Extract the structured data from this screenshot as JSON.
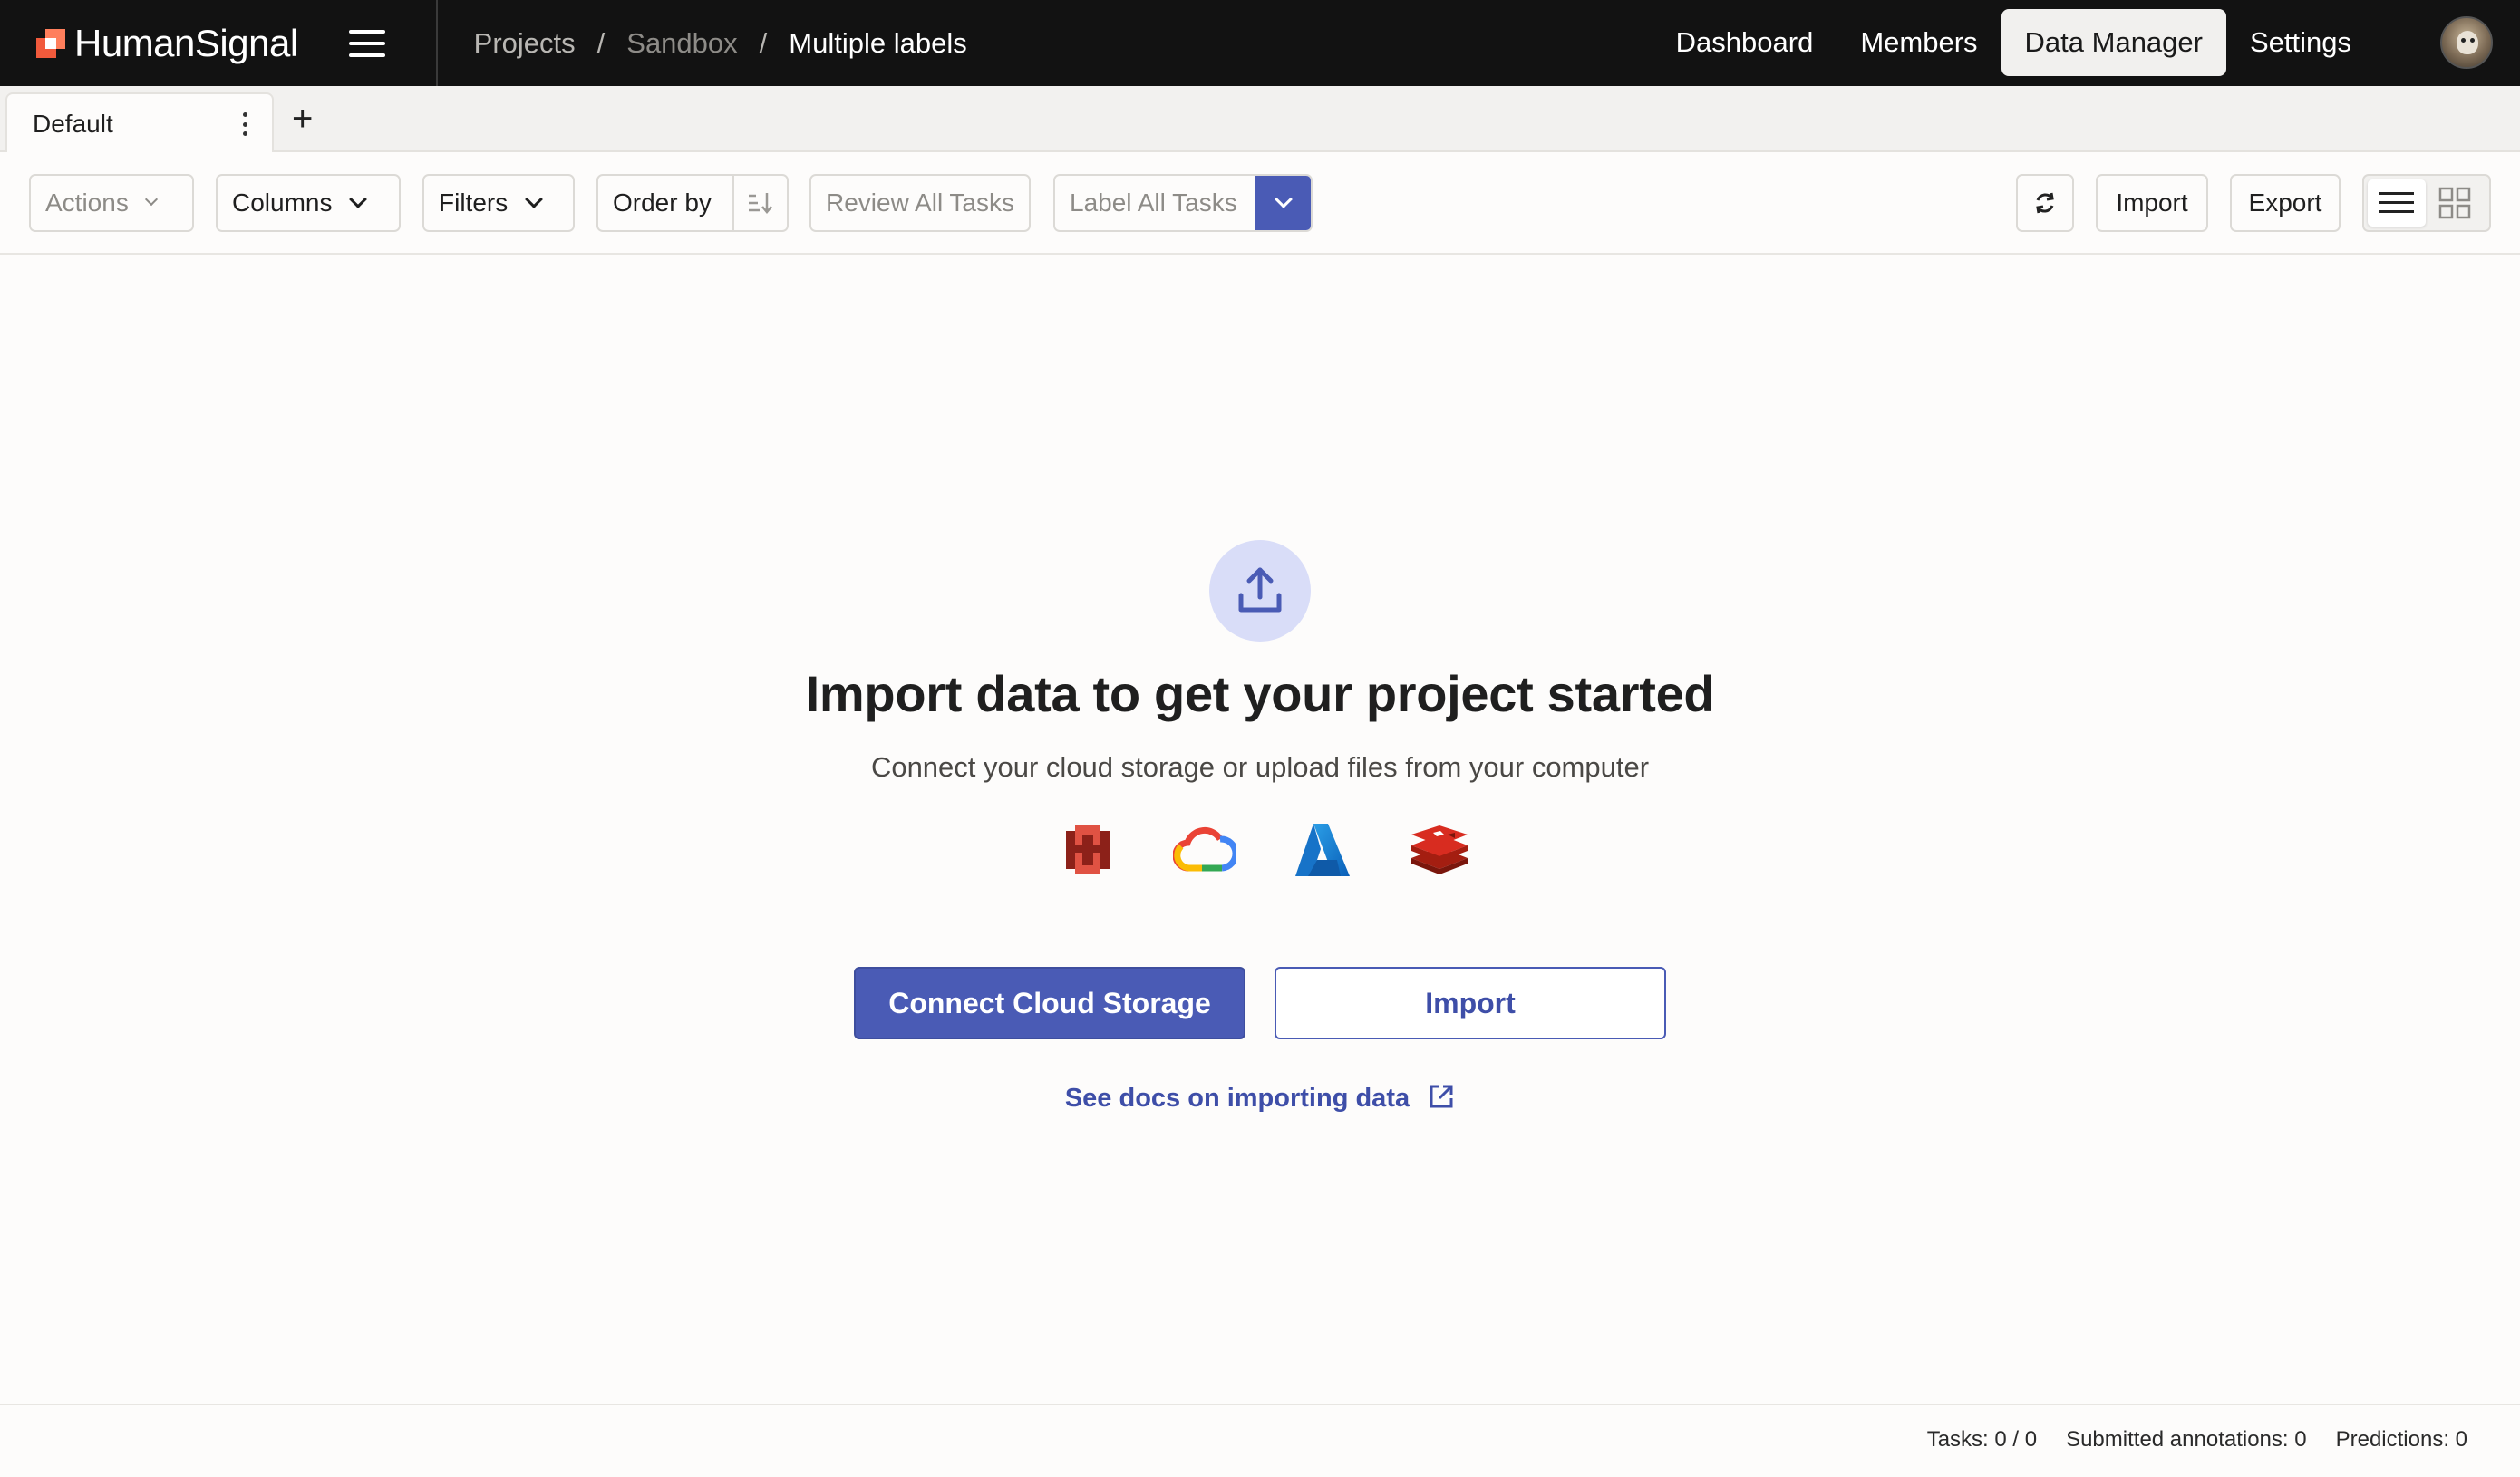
{
  "brand": {
    "name": "HumanSignal"
  },
  "breadcrumb": [
    {
      "label": "Projects"
    },
    {
      "label": "Sandbox"
    },
    {
      "label": "Multiple labels"
    }
  ],
  "breadcrumb_separator": "/",
  "topnav": {
    "dashboard": "Dashboard",
    "members": "Members",
    "data_manager": "Data Manager",
    "settings": "Settings",
    "active": "Data Manager"
  },
  "tabs": [
    {
      "label": "Default",
      "active": true
    }
  ],
  "tab_add_label": "+",
  "toolbar": {
    "actions": "Actions",
    "columns": "Columns",
    "filters": "Filters",
    "order_by": "Order by",
    "review_all": "Review All Tasks",
    "label_all": "Label All Tasks",
    "import": "Import",
    "export": "Export",
    "view_mode": "list"
  },
  "empty_state": {
    "title": "Import data to get your project started",
    "subtitle": "Connect your cloud storage or upload files from your computer",
    "providers": [
      "aws-s3-icon",
      "google-cloud-icon",
      "azure-icon",
      "redis-icon"
    ],
    "connect_button": "Connect Cloud Storage",
    "import_button": "Import",
    "docs_link": "See docs on importing data"
  },
  "footer": {
    "tasks": "Tasks: 0 / 0",
    "submitted_annotations": "Submitted annotations: 0",
    "predictions": "Predictions: 0"
  },
  "colors": {
    "accent": "#4a5bb5",
    "topbar": "#121212",
    "brand_orange": "#f15a3c",
    "upload_circle": "#d9ddf8"
  }
}
